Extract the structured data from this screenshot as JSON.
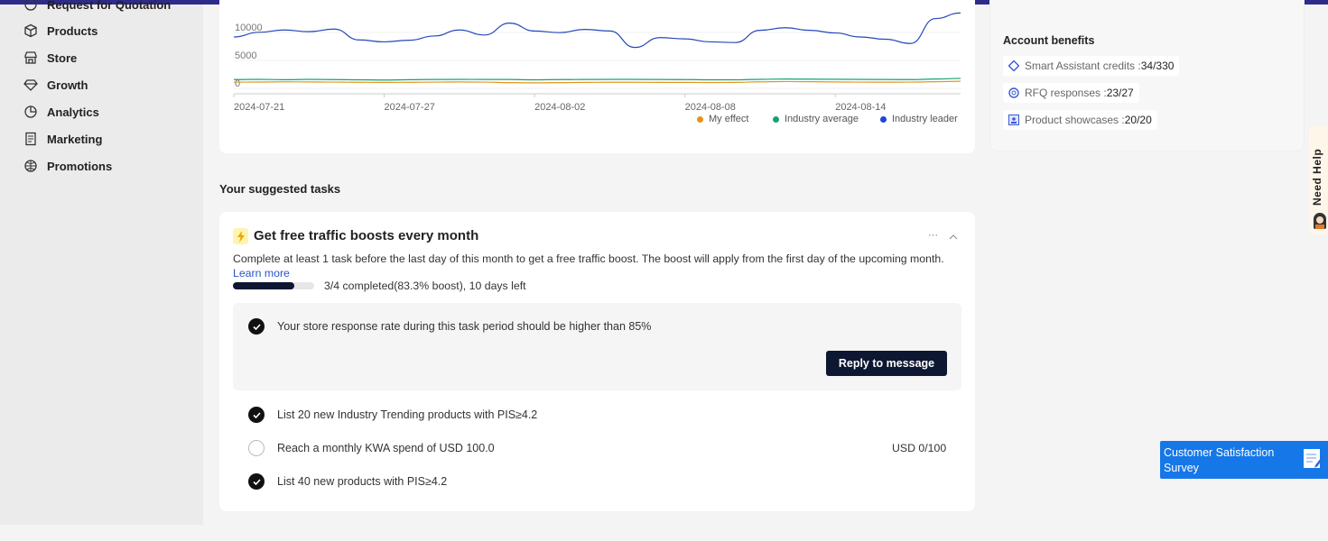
{
  "sidebar": {
    "items": [
      {
        "label": "Request for Quotation",
        "icon": "rfq-icon"
      },
      {
        "label": "Products",
        "icon": "box-icon"
      },
      {
        "label": "Store",
        "icon": "store-icon"
      },
      {
        "label": "Growth",
        "icon": "diamond-icon"
      },
      {
        "label": "Analytics",
        "icon": "pie-chart-icon"
      },
      {
        "label": "Marketing",
        "icon": "ad-icon"
      },
      {
        "label": "Promotions",
        "icon": "globe-icon"
      }
    ]
  },
  "chart_data": {
    "type": "line",
    "x": [
      "2024-07-21",
      "2024-07-22",
      "2024-07-23",
      "2024-07-24",
      "2024-07-25",
      "2024-07-26",
      "2024-07-27",
      "2024-07-28",
      "2024-07-29",
      "2024-07-30",
      "2024-07-31",
      "2024-08-01",
      "2024-08-02",
      "2024-08-03",
      "2024-08-04",
      "2024-08-05",
      "2024-08-06",
      "2024-08-07",
      "2024-08-08",
      "2024-08-09",
      "2024-08-10",
      "2024-08-11",
      "2024-08-12",
      "2024-08-13",
      "2024-08-14",
      "2024-08-15",
      "2024-08-16",
      "2024-08-17",
      "2024-08-18",
      "2024-08-19"
    ],
    "xticks": [
      "2024-07-21",
      "2024-07-27",
      "2024-08-02",
      "2024-08-08",
      "2024-08-14"
    ],
    "yticks": [
      "0",
      "5000",
      "10000"
    ],
    "ylim": [
      0,
      12500
    ],
    "series": [
      {
        "name": "My effect",
        "color": "#e8921e",
        "values": [
          150,
          160,
          200,
          180,
          150,
          120,
          100,
          120,
          150,
          180,
          150,
          60,
          20,
          60,
          100,
          120,
          120,
          100,
          100,
          80,
          100,
          200,
          250,
          220,
          180,
          150,
          140,
          150,
          220,
          300
        ]
      },
      {
        "name": "Industry average",
        "color": "#16a36b",
        "values": [
          600,
          650,
          580,
          640,
          600,
          560,
          520,
          580,
          620,
          640,
          630,
          620,
          560,
          600,
          620,
          640,
          640,
          620,
          600,
          560,
          560,
          650,
          700,
          680,
          660,
          640,
          620,
          600,
          700,
          820
        ]
      },
      {
        "name": "Industry leader",
        "color": "#2548b8",
        "values": [
          8230,
          9060,
          9470,
          9170,
          9640,
          7700,
          7350,
          7640,
          8400,
          9470,
          8580,
          10700,
          9290,
          9000,
          9580,
          9290,
          6350,
          8110,
          7880,
          7350,
          7230,
          9410,
          9880,
          9410,
          8940,
          8230,
          7820,
          7060,
          11520,
          12520
        ]
      }
    ],
    "legend": "bottom-right",
    "grid": true
  },
  "benefits": {
    "title": "Account benefits",
    "items": [
      {
        "label": "Smart Assistant credits : ",
        "value": "34/330",
        "icon": "sparkle-icon"
      },
      {
        "label": "RFQ responses : ",
        "value": "23/27",
        "icon": "rfq-response-icon"
      },
      {
        "label": "Product showcases : ",
        "value": "20/20",
        "icon": "showcase-icon"
      }
    ]
  },
  "tasks": {
    "section_title": "Your suggested tasks",
    "card_title": "Get free traffic boosts every month",
    "description": "Complete at least 1 task before the last day of this month to get a free traffic boost. The boost will apply from the first day of the upcoming month.",
    "learn_more": "Learn more",
    "progress": 0.75,
    "progress_text": "3/4 completed(83.3% boost), 10 days left",
    "more": "···",
    "highlight": {
      "text": "Your store response rate during this task period should be higher than 85%",
      "done": true,
      "button": "Reply to message"
    },
    "items": [
      {
        "text": "List 20 new Industry Trending products with PIS≥4.2",
        "done": true,
        "status": ""
      },
      {
        "text": "Reach a monthly KWA spend of USD 100.0",
        "done": false,
        "status": "USD 0/100"
      },
      {
        "text": "List 40 new products with PIS≥4.2",
        "done": true,
        "status": ""
      }
    ]
  },
  "help": {
    "label": "Need Help"
  },
  "survey": {
    "label": "Customer Satisfaction Survey"
  },
  "colors": {
    "accent": "#2e2b8a",
    "primary_button": "#0d1731",
    "survey": "#1677e8",
    "link": "#2b55c9"
  }
}
